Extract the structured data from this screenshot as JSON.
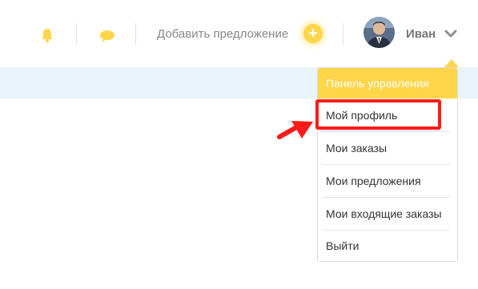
{
  "header": {
    "add_offer_label": "Добавить предложение",
    "add_button_glyph": "+",
    "user_name": "Иван"
  },
  "dropdown": {
    "header": "Панель управления",
    "items": [
      {
        "label": "Мой профиль"
      },
      {
        "label": "Мои заказы"
      },
      {
        "label": "Мои предложения"
      },
      {
        "label": "Мои входящие заказы"
      },
      {
        "label": "Выйти"
      }
    ]
  },
  "colors": {
    "accent": "#ffd54a",
    "annotation": "#ff1a1a",
    "band": "#e9f3fb"
  },
  "icons": [
    "bell-icon",
    "chat-icon",
    "plus-icon",
    "avatar",
    "chevron-down-icon",
    "annotation-arrow"
  ]
}
